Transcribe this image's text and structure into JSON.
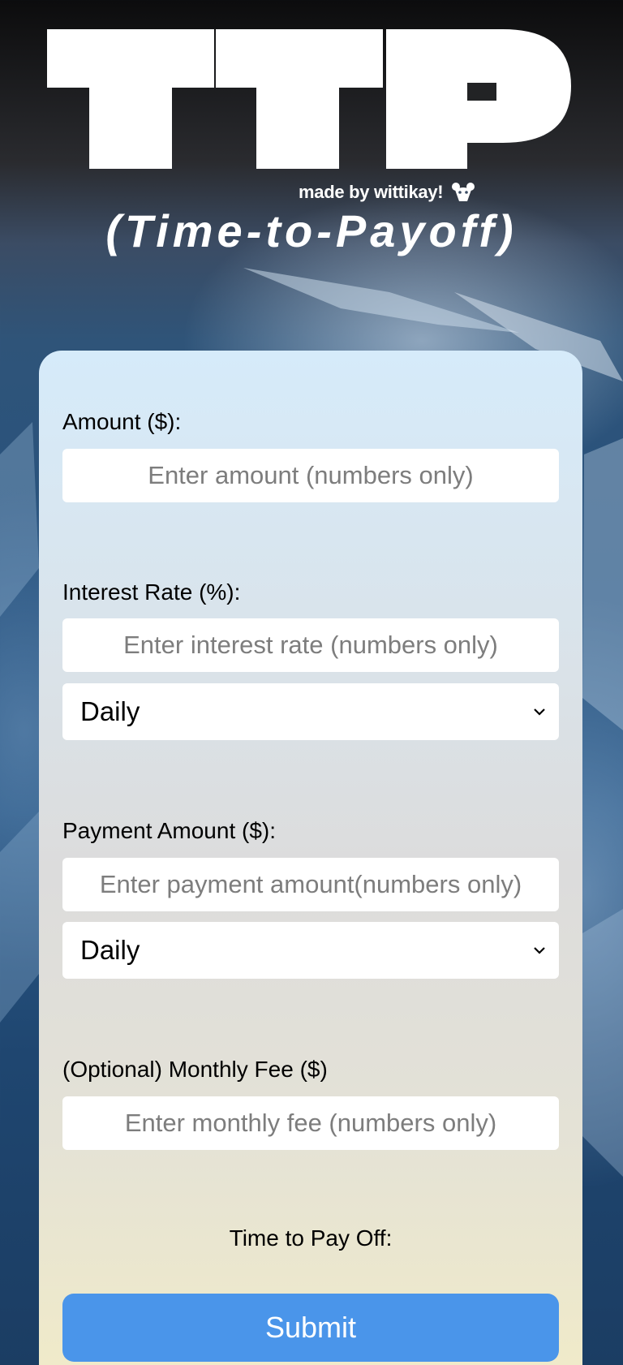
{
  "header": {
    "logo_text": "TTP",
    "made_by": "made by wittikay!",
    "subtitle": "(Time-to-Payoff)"
  },
  "form": {
    "amount": {
      "label": "Amount ($):",
      "placeholder": "Enter amount (numbers only)"
    },
    "interest_rate": {
      "label": "Interest Rate (%):",
      "placeholder": "Enter interest rate (numbers only)",
      "period_selected": "Daily"
    },
    "payment_amount": {
      "label": "Payment Amount ($):",
      "placeholder": "Enter payment amount(numbers only)",
      "period_selected": "Daily"
    },
    "monthly_fee": {
      "label": "(Optional) Monthly Fee ($)",
      "placeholder": "Enter monthly fee (numbers only)"
    },
    "result_label": "Time to Pay Off:",
    "submit_label": "Submit"
  },
  "icons": {
    "made_by": "bear-head-icon",
    "select_arrow": "chevron-down-icon"
  },
  "colors": {
    "accent": "#4a95ea",
    "card_top": "#d6ebfa",
    "card_bottom": "#f1ebc8",
    "text": "#000000",
    "placeholder": "#7d7d7d"
  }
}
